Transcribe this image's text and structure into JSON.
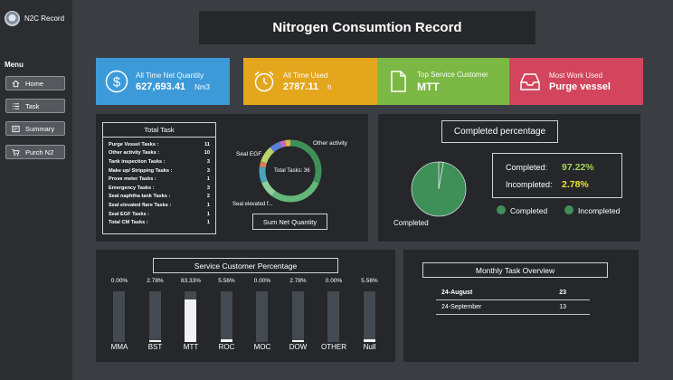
{
  "app": {
    "title": "N2C Record"
  },
  "sidebar": {
    "menu_label": "Menu",
    "items": [
      {
        "label": "Home",
        "icon": "home-icon"
      },
      {
        "label": "Task",
        "icon": "list-icon"
      },
      {
        "label": "Summary",
        "icon": "summary-icon"
      },
      {
        "label": "Purch N2",
        "icon": "cart-icon"
      }
    ]
  },
  "header": {
    "title": "Nitrogen Consumtion Record"
  },
  "kpis": [
    {
      "label": "All Time Net Quantity",
      "value": "627,693.41",
      "unit": "Nm3",
      "color": "#3d9ad8",
      "icon": "dollar-circle-icon"
    },
    {
      "label": "All Time Used",
      "value": "2787.11",
      "unit": "h",
      "color": "#e3a61d",
      "icon": "alarm-clock-icon"
    },
    {
      "label": "Top Service Customer",
      "value": "MTT",
      "unit": "",
      "color": "#7cb844",
      "icon": "document-icon"
    },
    {
      "label": "Most Work Used",
      "value": "Purge vessel",
      "unit": "",
      "color": "#d2455d",
      "icon": "inbox-icon"
    }
  ],
  "total_task": {
    "title": "Total Task",
    "rows": [
      {
        "label": "Purge Vessel Tasks :",
        "value": "11"
      },
      {
        "label": "Other activity Tasks :",
        "value": "10"
      },
      {
        "label": "Tank inspection Tasks :",
        "value": "3"
      },
      {
        "label": "Make up/ Stripping Tasks :",
        "value": "3"
      },
      {
        "label": "Prove meter Tasks :",
        "value": "1"
      },
      {
        "label": "Emergency Tasks :",
        "value": "3"
      },
      {
        "label": "Seal naphtha tank Tasks :",
        "value": "2"
      },
      {
        "label": "Seal elevated flare Tasks :",
        "value": "1"
      },
      {
        "label": "Seal EGF Tasks :",
        "value": "1"
      },
      {
        "label": "Total CM Tasks :",
        "value": "1"
      }
    ],
    "donut_center": "Total Tasks: 36",
    "donut_labels": {
      "left": "Seal EGF",
      "right": "Other activity",
      "bottom": "Seal elevated f..."
    },
    "button": "Sum Net Quantity"
  },
  "completed": {
    "title": "Completed percentage",
    "completed_label": "Completed:",
    "completed_value": "97.22%",
    "incompleted_label": "Incompleted:",
    "incompleted_value": "2.78%",
    "pie_label": "Completed",
    "legend": [
      "Completed",
      "Incompleted"
    ],
    "value_color": "#e8e32a",
    "pie_color": "#3f8f59"
  },
  "service": {
    "title": "Service Customer Percentage"
  },
  "monthly": {
    "title": "Monthly Task Overview",
    "rows": [
      {
        "month": "24-August",
        "count": "23"
      },
      {
        "month": "24-September",
        "count": "13"
      }
    ]
  },
  "chart_data": [
    {
      "type": "bar",
      "title": "Service Customer Percentage",
      "categories": [
        "MMA",
        "BST",
        "MTT",
        "ROC",
        "MOC",
        "DOW",
        "OTHER",
        "Null"
      ],
      "values": [
        0.0,
        2.78,
        83.33,
        5.56,
        0.0,
        2.78,
        0.0,
        5.56
      ],
      "value_labels": [
        "0.00%",
        "2.78%",
        "83.33%",
        "5.56%",
        "0.00%",
        "2.78%",
        "0.00%",
        "5.56%"
      ],
      "ylim": [
        0,
        100
      ]
    },
    {
      "type": "pie",
      "title": "Completed percentage",
      "categories": [
        "Completed",
        "Incompleted"
      ],
      "values": [
        97.22,
        2.78
      ]
    }
  ]
}
